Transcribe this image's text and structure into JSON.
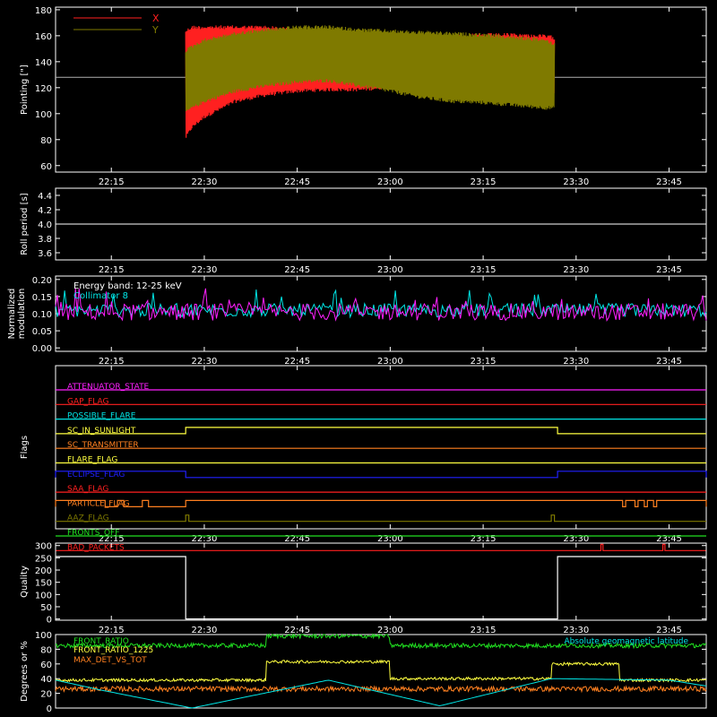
{
  "colors": {
    "background": "#000000",
    "axes": "#ffffff",
    "red": "#ff2020",
    "olive": "#7f7a00",
    "cyan": "#00e5e5",
    "magenta": "#ff20ff",
    "yellow": "#ffff40",
    "green": "#20e020",
    "orange": "#ff8020",
    "blue": "#2020ff"
  },
  "chart_data": [
    {
      "type": "line",
      "ylabel": "Pointing [\"]",
      "xlim": [
        "22:06",
        "23:51"
      ],
      "ylim": [
        55,
        182
      ],
      "xticks": [
        "22:15",
        "22:30",
        "22:45",
        "23:00",
        "23:15",
        "23:30",
        "23:45"
      ],
      "yticks": [
        "60",
        "80",
        "100",
        "120",
        "140",
        "160",
        "180"
      ],
      "grid": false,
      "legend_position": "top-left",
      "reference_line": 128,
      "series": [
        {
          "name": "X",
          "color": "#ff2020",
          "x": [
            "22:27",
            "22:28",
            "22:30",
            "22:35",
            "22:40",
            "22:45",
            "22:50",
            "22:55",
            "23:00",
            "23:05",
            "23:10",
            "23:15",
            "23:20",
            "23:25",
            "23:26:30"
          ],
          "upper": [
            165,
            168,
            168,
            168,
            168,
            166,
            163,
            160,
            160,
            160,
            161,
            162,
            162,
            161,
            160
          ],
          "lower": [
            80,
            88,
            96,
            108,
            113,
            116,
            117,
            117,
            119,
            123,
            128,
            133,
            138,
            143,
            112
          ]
        },
        {
          "name": "Y",
          "color": "#7f7a00",
          "x": [
            "22:27",
            "22:28",
            "22:30",
            "22:35",
            "22:40",
            "22:45",
            "22:50",
            "22:55",
            "23:00",
            "23:05",
            "23:10",
            "23:15",
            "23:20",
            "23:25",
            "23:26:30"
          ],
          "upper": [
            150,
            153,
            158,
            163,
            166,
            168,
            168,
            166,
            165,
            164,
            163,
            162,
            160,
            158,
            155
          ],
          "lower": [
            100,
            103,
            108,
            116,
            120,
            123,
            124,
            120,
            116,
            111,
            108,
            107,
            105,
            103,
            103
          ]
        }
      ]
    },
    {
      "type": "line",
      "ylabel": "Roll period [s]",
      "xlim": [
        "22:06",
        "23:51"
      ],
      "ylim": [
        3.5,
        4.5
      ],
      "xticks": [
        "22:15",
        "22:30",
        "22:45",
        "23:00",
        "23:15",
        "23:30",
        "23:45"
      ],
      "yticks": [
        "3.6",
        "3.8",
        "4.0",
        "4.2",
        "4.4"
      ],
      "series": [
        {
          "name": "",
          "color": "#ffffff",
          "x": [
            "22:06",
            "23:51"
          ],
          "y": [
            4.0,
            4.0
          ]
        }
      ]
    },
    {
      "type": "line",
      "ylabel_lines": [
        "Normalized",
        "modulation"
      ],
      "xlim": [
        "22:06",
        "23:51"
      ],
      "ylim": [
        -0.01,
        0.21
      ],
      "xticks": [
        "22:15",
        "22:30",
        "22:45",
        "23:00",
        "23:15",
        "23:30",
        "23:45"
      ],
      "yticks": [
        "0.00",
        "0.05",
        "0.10",
        "0.15",
        "0.20"
      ],
      "annotations": [
        "Energy band: 12-25 keV",
        "Collimator 8"
      ],
      "series": [
        {
          "name": "Collimator 8",
          "color": "#00e5e5",
          "mean": 0.11,
          "spread": 0.04
        },
        {
          "name": "",
          "color": "#ff20ff",
          "mean": 0.105,
          "spread": 0.05
        }
      ]
    },
    {
      "type": "line",
      "ylabel": "Flags",
      "xlim": [
        "22:06",
        "23:51"
      ],
      "xticks": [
        "22:15",
        "22:30",
        "22:45",
        "23:00",
        "23:15",
        "23:30",
        "23:45"
      ],
      "flags": [
        {
          "name": "ATTENUATOR_STATE",
          "color": "#ff20ff",
          "on": []
        },
        {
          "name": "GAP_FLAG",
          "color": "#ff2020",
          "on": []
        },
        {
          "name": "POSSIBLE_FLARE",
          "color": "#00e5e5",
          "on": []
        },
        {
          "name": "SC_IN_SUNLIGHT",
          "color": "#ffff40",
          "on": [
            [
              "22:27",
              "23:27"
            ]
          ]
        },
        {
          "name": "SC_TRANSMITTER",
          "color": "#ff8020",
          "on": []
        },
        {
          "name": "FLARE_FLAG",
          "color": "#ffff40",
          "on": []
        },
        {
          "name": "ECLIPSE_FLAG",
          "color": "#2020ff",
          "on": [
            [
              "22:06",
              "22:27"
            ],
            [
              "23:27",
              "23:51"
            ]
          ]
        },
        {
          "name": "SAA_FLAG",
          "color": "#ff2020",
          "on": []
        },
        {
          "name": "PARTICLE_FLAG",
          "color": "#ff8020",
          "on": [
            [
              "22:06",
              "22:14"
            ],
            [
              "22:16",
              "22:17"
            ],
            [
              "22:20",
              "22:21"
            ],
            [
              "22:27",
              "23:37:30"
            ],
            [
              "23:38",
              "23:39:30"
            ],
            [
              "23:40",
              "23:41"
            ],
            [
              "23:41:30",
              "23:42:30"
            ],
            [
              "23:43",
              "23:51"
            ]
          ]
        },
        {
          "name": "AAZ_FLAG",
          "color": "#7f7a00",
          "on": [
            [
              "22:27",
              "22:27:30"
            ],
            [
              "23:26",
              "23:26:30"
            ]
          ]
        },
        {
          "name": "FRONTS_OFF",
          "color": "#20e020",
          "on": []
        },
        {
          "name": "BAD_PACKETS",
          "color": "#ff2020",
          "on": [
            [
              "23:34",
              "23:34:20"
            ],
            [
              "23:44",
              "23:44:20"
            ]
          ]
        }
      ]
    },
    {
      "type": "line",
      "ylabel": "Quality",
      "xlim": [
        "22:06",
        "23:51"
      ],
      "ylim": [
        -5,
        310
      ],
      "xticks": [
        "22:15",
        "22:30",
        "22:45",
        "23:00",
        "23:15",
        "23:30",
        "23:45"
      ],
      "yticks": [
        "0",
        "50",
        "100",
        "150",
        "200",
        "250",
        "300"
      ],
      "series": [
        {
          "name": "",
          "color": "#ffffff",
          "x": [
            "22:06",
            "22:27",
            "22:27",
            "23:27",
            "23:27",
            "23:51"
          ],
          "y": [
            255,
            255,
            0,
            0,
            255,
            255
          ]
        }
      ]
    },
    {
      "type": "line",
      "ylabel": "Degrees or %",
      "xlim": [
        "22:06",
        "23:51"
      ],
      "ylim": [
        0,
        100
      ],
      "yticks": [
        "0",
        "20",
        "40",
        "60",
        "80",
        "100"
      ],
      "series": [
        {
          "name": "FRONT_RATIO",
          "color": "#20e020",
          "x": [
            "22:06",
            "22:40",
            "22:40",
            "23:00",
            "23:00",
            "23:51"
          ],
          "y": [
            85,
            85,
            98,
            98,
            85,
            85
          ]
        },
        {
          "name": "FRONT_RATIO_1225",
          "color": "#ffff40",
          "x": [
            "22:06",
            "22:40",
            "22:40",
            "23:00",
            "23:00",
            "23:26",
            "23:26",
            "23:37",
            "23:37",
            "23:51"
          ],
          "y": [
            38,
            38,
            63,
            63,
            40,
            40,
            60,
            60,
            38,
            38
          ]
        },
        {
          "name": "MAX_DET_VS_TOT",
          "color": "#ff8020",
          "x": [
            "22:06",
            "23:51"
          ],
          "y": [
            26,
            26
          ]
        },
        {
          "name": "Absolute geomagnetic latitude",
          "color": "#00e5e5",
          "x": [
            "22:06",
            "22:13",
            "22:28",
            "22:50",
            "23:08",
            "23:26",
            "23:45",
            "23:51"
          ],
          "y": [
            38,
            25,
            0,
            38,
            3,
            40,
            38,
            30
          ]
        }
      ]
    }
  ]
}
